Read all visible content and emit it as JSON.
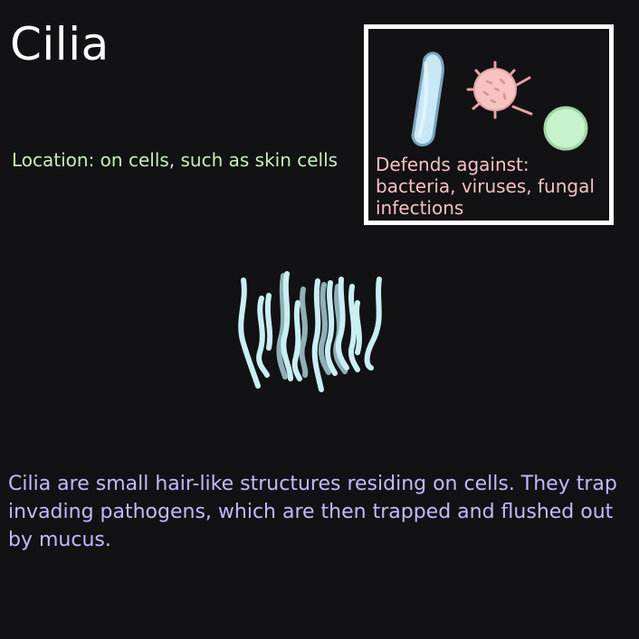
{
  "page": {
    "title": "Cilia",
    "location_text": "Location: on cells, such as skin cells",
    "defends_text": "Defends against:\nbacteria, viruses, fungal\ninfections",
    "description": "Cilia are small hair-like structures residing on cells. They trap invading pathogens, which are then trapped and flushed out by mucus."
  },
  "colors": {
    "background": "#121214",
    "title": "#ffffff",
    "location_text": "#c6f0b8",
    "defends_text": "#f6c0c4",
    "description": "#c5b8ff",
    "box_border": "#ffffff",
    "bacterium": "#c9e8f6",
    "virus": "#f7c2c2",
    "fungal_spore": "#c7f2cc",
    "cilia": "#c9eef4"
  },
  "icons": {
    "bacterium": "bacterium-icon",
    "virus": "virus-icon",
    "fungus": "fungal-spore-icon",
    "cilia": "cilia-illustration"
  }
}
